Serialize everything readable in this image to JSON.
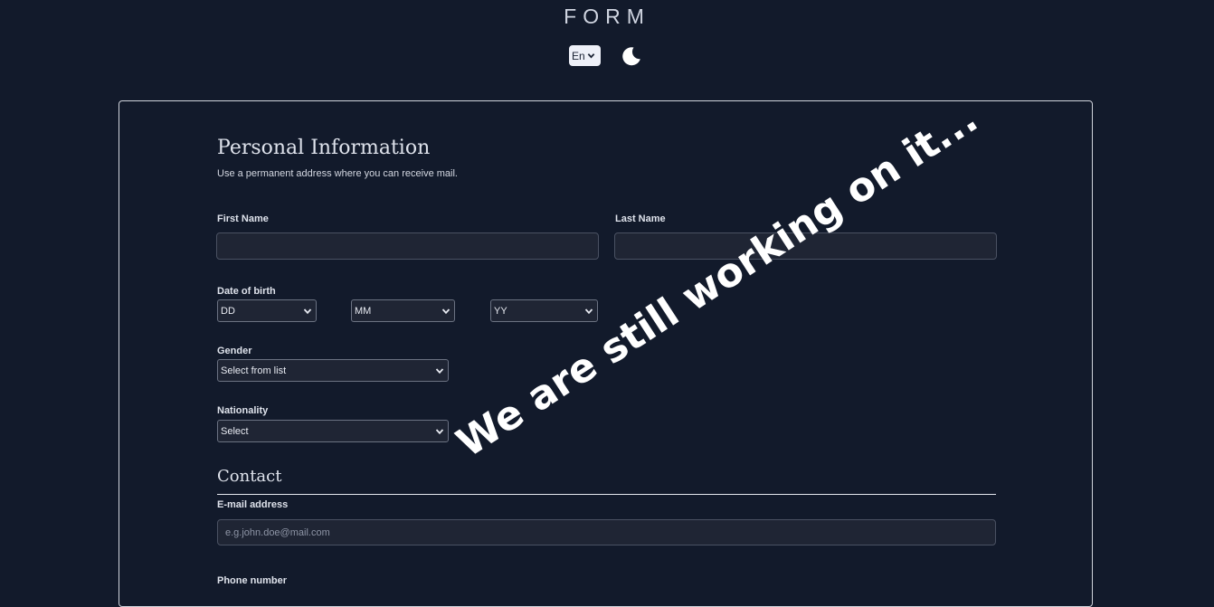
{
  "header": {
    "title": "FORM",
    "language": "En",
    "theme_icon": "moon-icon"
  },
  "personal": {
    "title": "Personal Information",
    "subtitle": "Use a permanent address where you can receive mail.",
    "first_name_label": "First Name",
    "first_name_value": "",
    "last_name_label": "Last Name",
    "last_name_value": "",
    "dob_label": "Date of birth",
    "dob_day": "DD",
    "dob_month": "MM",
    "dob_year": "YY",
    "gender_label": "Gender",
    "gender_value": "Select from list",
    "nationality_label": "Nationality",
    "nationality_value": "Select"
  },
  "contact": {
    "title": "Contact",
    "email_label": "E-mail address",
    "email_placeholder": "e.g.john.doe@mail.com",
    "phone_label": "Phone number"
  },
  "watermark": "We are still working on it..."
}
